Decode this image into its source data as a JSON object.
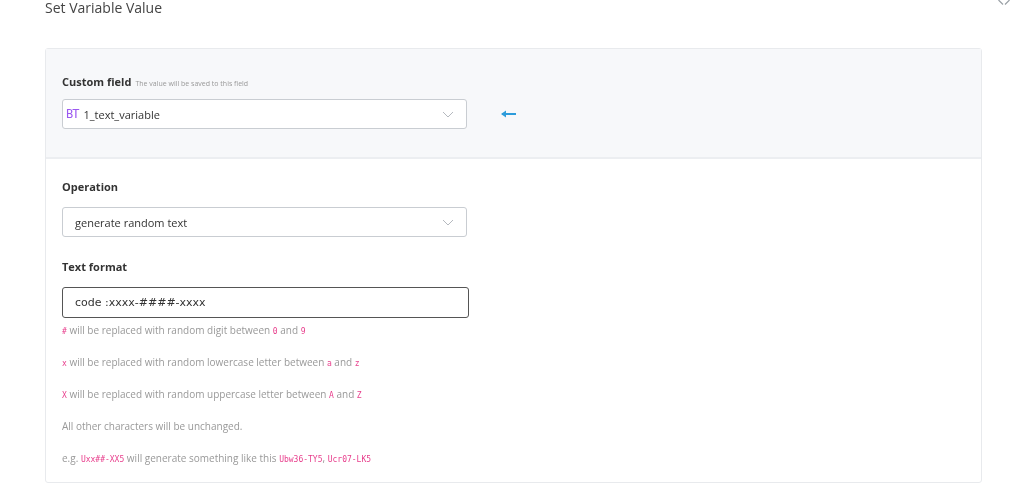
{
  "dialog": {
    "title": "Set Variable Value"
  },
  "custom_field": {
    "label": "Custom field",
    "hint": "The value will be saved to this field",
    "type_badge": "BT",
    "value": "1_text_variable"
  },
  "operation": {
    "label": "Operation",
    "value": "generate random text"
  },
  "text_format": {
    "label": "Text format",
    "value": "code :xxxx-####-xxxx"
  },
  "hints": [
    [
      {
        "kind": "code",
        "text": "#"
      },
      {
        "kind": "text",
        "text": " will be replaced with random digit between "
      },
      {
        "kind": "code",
        "text": "0"
      },
      {
        "kind": "text",
        "text": " and "
      },
      {
        "kind": "code",
        "text": "9"
      }
    ],
    [
      {
        "kind": "code",
        "text": "x"
      },
      {
        "kind": "text",
        "text": " will be replaced with random lowercase letter between "
      },
      {
        "kind": "code",
        "text": "a"
      },
      {
        "kind": "text",
        "text": " and "
      },
      {
        "kind": "code",
        "text": "z"
      }
    ],
    [
      {
        "kind": "code",
        "text": "X"
      },
      {
        "kind": "text",
        "text": " will be replaced with random uppercase letter between "
      },
      {
        "kind": "code",
        "text": "A"
      },
      {
        "kind": "text",
        "text": " and "
      },
      {
        "kind": "code",
        "text": "Z"
      }
    ],
    [
      {
        "kind": "text",
        "text": "All other characters will be unchanged."
      }
    ],
    [
      {
        "kind": "text",
        "text": "e.g. "
      },
      {
        "kind": "code",
        "text": "Uxx##-XX5"
      },
      {
        "kind": "text",
        "text": " will generate something like this "
      },
      {
        "kind": "code",
        "text": "Ubw36-TY5"
      },
      {
        "kind": "text",
        "text": ", "
      },
      {
        "kind": "code",
        "text": "Ucr07-LK5"
      }
    ]
  ]
}
